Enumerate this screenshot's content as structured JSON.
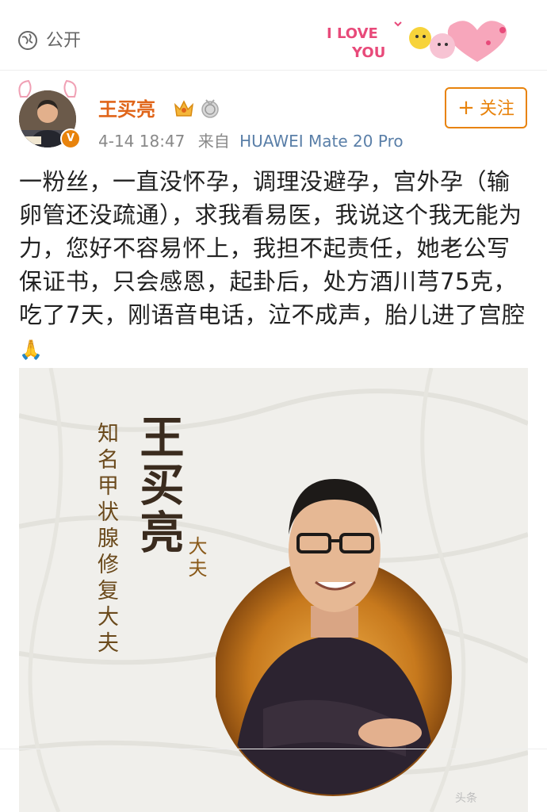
{
  "header": {
    "visibility_label": "公开",
    "decoration": {
      "line1": "I LOVE",
      "line2": "YOU"
    }
  },
  "post": {
    "username": "王买亮",
    "timestamp": "4-14 18:47",
    "source_prefix": "来自",
    "device": "HUAWEI Mate 20 Pro",
    "follow_label": "关注",
    "text": "一粉丝，一直没怀孕，调理没避孕，宫外孕（输卵管还没疏通），求我看易医，我说这个我无能为力，您好不容易怀上，我担不起责任，她老公写保证书，只会感恩，起卦后，处方酒川芎75克，吃了7天，刚语音电话，泣不成声，胎儿进了宫腔",
    "emoji": "🙏"
  },
  "image": {
    "name_vertical": "王买亮",
    "title_vertical": "知名甲状腺修复大夫",
    "suffix_vertical": "大夫",
    "watermark": "头条"
  },
  "colors": {
    "accent": "#e8830c",
    "username": "#e0651a",
    "device_link": "#5a7fa8"
  }
}
